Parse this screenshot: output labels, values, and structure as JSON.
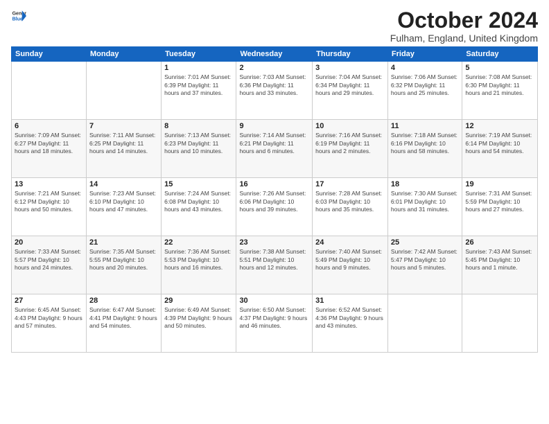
{
  "logo": {
    "general": "General",
    "blue": "Blue"
  },
  "title": "October 2024",
  "location": "Fulham, England, United Kingdom",
  "weekdays": [
    "Sunday",
    "Monday",
    "Tuesday",
    "Wednesday",
    "Thursday",
    "Friday",
    "Saturday"
  ],
  "weeks": [
    [
      {
        "day": "",
        "detail": ""
      },
      {
        "day": "",
        "detail": ""
      },
      {
        "day": "1",
        "detail": "Sunrise: 7:01 AM\nSunset: 6:39 PM\nDaylight: 11 hours\nand 37 minutes."
      },
      {
        "day": "2",
        "detail": "Sunrise: 7:03 AM\nSunset: 6:36 PM\nDaylight: 11 hours\nand 33 minutes."
      },
      {
        "day": "3",
        "detail": "Sunrise: 7:04 AM\nSunset: 6:34 PM\nDaylight: 11 hours\nand 29 minutes."
      },
      {
        "day": "4",
        "detail": "Sunrise: 7:06 AM\nSunset: 6:32 PM\nDaylight: 11 hours\nand 25 minutes."
      },
      {
        "day": "5",
        "detail": "Sunrise: 7:08 AM\nSunset: 6:30 PM\nDaylight: 11 hours\nand 21 minutes."
      }
    ],
    [
      {
        "day": "6",
        "detail": "Sunrise: 7:09 AM\nSunset: 6:27 PM\nDaylight: 11 hours\nand 18 minutes."
      },
      {
        "day": "7",
        "detail": "Sunrise: 7:11 AM\nSunset: 6:25 PM\nDaylight: 11 hours\nand 14 minutes."
      },
      {
        "day": "8",
        "detail": "Sunrise: 7:13 AM\nSunset: 6:23 PM\nDaylight: 11 hours\nand 10 minutes."
      },
      {
        "day": "9",
        "detail": "Sunrise: 7:14 AM\nSunset: 6:21 PM\nDaylight: 11 hours\nand 6 minutes."
      },
      {
        "day": "10",
        "detail": "Sunrise: 7:16 AM\nSunset: 6:19 PM\nDaylight: 11 hours\nand 2 minutes."
      },
      {
        "day": "11",
        "detail": "Sunrise: 7:18 AM\nSunset: 6:16 PM\nDaylight: 10 hours\nand 58 minutes."
      },
      {
        "day": "12",
        "detail": "Sunrise: 7:19 AM\nSunset: 6:14 PM\nDaylight: 10 hours\nand 54 minutes."
      }
    ],
    [
      {
        "day": "13",
        "detail": "Sunrise: 7:21 AM\nSunset: 6:12 PM\nDaylight: 10 hours\nand 50 minutes."
      },
      {
        "day": "14",
        "detail": "Sunrise: 7:23 AM\nSunset: 6:10 PM\nDaylight: 10 hours\nand 47 minutes."
      },
      {
        "day": "15",
        "detail": "Sunrise: 7:24 AM\nSunset: 6:08 PM\nDaylight: 10 hours\nand 43 minutes."
      },
      {
        "day": "16",
        "detail": "Sunrise: 7:26 AM\nSunset: 6:06 PM\nDaylight: 10 hours\nand 39 minutes."
      },
      {
        "day": "17",
        "detail": "Sunrise: 7:28 AM\nSunset: 6:03 PM\nDaylight: 10 hours\nand 35 minutes."
      },
      {
        "day": "18",
        "detail": "Sunrise: 7:30 AM\nSunset: 6:01 PM\nDaylight: 10 hours\nand 31 minutes."
      },
      {
        "day": "19",
        "detail": "Sunrise: 7:31 AM\nSunset: 5:59 PM\nDaylight: 10 hours\nand 27 minutes."
      }
    ],
    [
      {
        "day": "20",
        "detail": "Sunrise: 7:33 AM\nSunset: 5:57 PM\nDaylight: 10 hours\nand 24 minutes."
      },
      {
        "day": "21",
        "detail": "Sunrise: 7:35 AM\nSunset: 5:55 PM\nDaylight: 10 hours\nand 20 minutes."
      },
      {
        "day": "22",
        "detail": "Sunrise: 7:36 AM\nSunset: 5:53 PM\nDaylight: 10 hours\nand 16 minutes."
      },
      {
        "day": "23",
        "detail": "Sunrise: 7:38 AM\nSunset: 5:51 PM\nDaylight: 10 hours\nand 12 minutes."
      },
      {
        "day": "24",
        "detail": "Sunrise: 7:40 AM\nSunset: 5:49 PM\nDaylight: 10 hours\nand 9 minutes."
      },
      {
        "day": "25",
        "detail": "Sunrise: 7:42 AM\nSunset: 5:47 PM\nDaylight: 10 hours\nand 5 minutes."
      },
      {
        "day": "26",
        "detail": "Sunrise: 7:43 AM\nSunset: 5:45 PM\nDaylight: 10 hours\nand 1 minute."
      }
    ],
    [
      {
        "day": "27",
        "detail": "Sunrise: 6:45 AM\nSunset: 4:43 PM\nDaylight: 9 hours\nand 57 minutes."
      },
      {
        "day": "28",
        "detail": "Sunrise: 6:47 AM\nSunset: 4:41 PM\nDaylight: 9 hours\nand 54 minutes."
      },
      {
        "day": "29",
        "detail": "Sunrise: 6:49 AM\nSunset: 4:39 PM\nDaylight: 9 hours\nand 50 minutes."
      },
      {
        "day": "30",
        "detail": "Sunrise: 6:50 AM\nSunset: 4:37 PM\nDaylight: 9 hours\nand 46 minutes."
      },
      {
        "day": "31",
        "detail": "Sunrise: 6:52 AM\nSunset: 4:36 PM\nDaylight: 9 hours\nand 43 minutes."
      },
      {
        "day": "",
        "detail": ""
      },
      {
        "day": "",
        "detail": ""
      }
    ]
  ]
}
